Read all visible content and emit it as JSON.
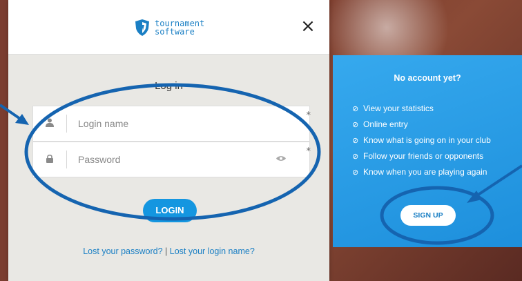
{
  "logo": {
    "line1": "tournament",
    "line2": "software"
  },
  "close_label": "×",
  "login": {
    "title": "Log in",
    "login_name_placeholder": "Login name",
    "password_placeholder": "Password",
    "required_mark": "*",
    "button_label": "LOGIN",
    "lost_password": "Lost your password?",
    "separator": "|",
    "lost_login_name": "Lost your login name?"
  },
  "signup": {
    "title": "No account yet?",
    "benefits": [
      "View your statistics",
      "Online entry",
      "Know what is going on in your club",
      "Follow your friends or opponents",
      "Know when you are playing again"
    ],
    "button_label": "SIGN UP"
  },
  "icons": {
    "user": "user-icon",
    "lock": "lock-icon",
    "eye": "eye-icon",
    "check": "check-circle-icon"
  },
  "colors": {
    "brand_blue": "#1a7fc4",
    "button_blue": "#1496e0",
    "annotation_blue": "#1564b0",
    "panel_bg": "#e9e8e4"
  }
}
